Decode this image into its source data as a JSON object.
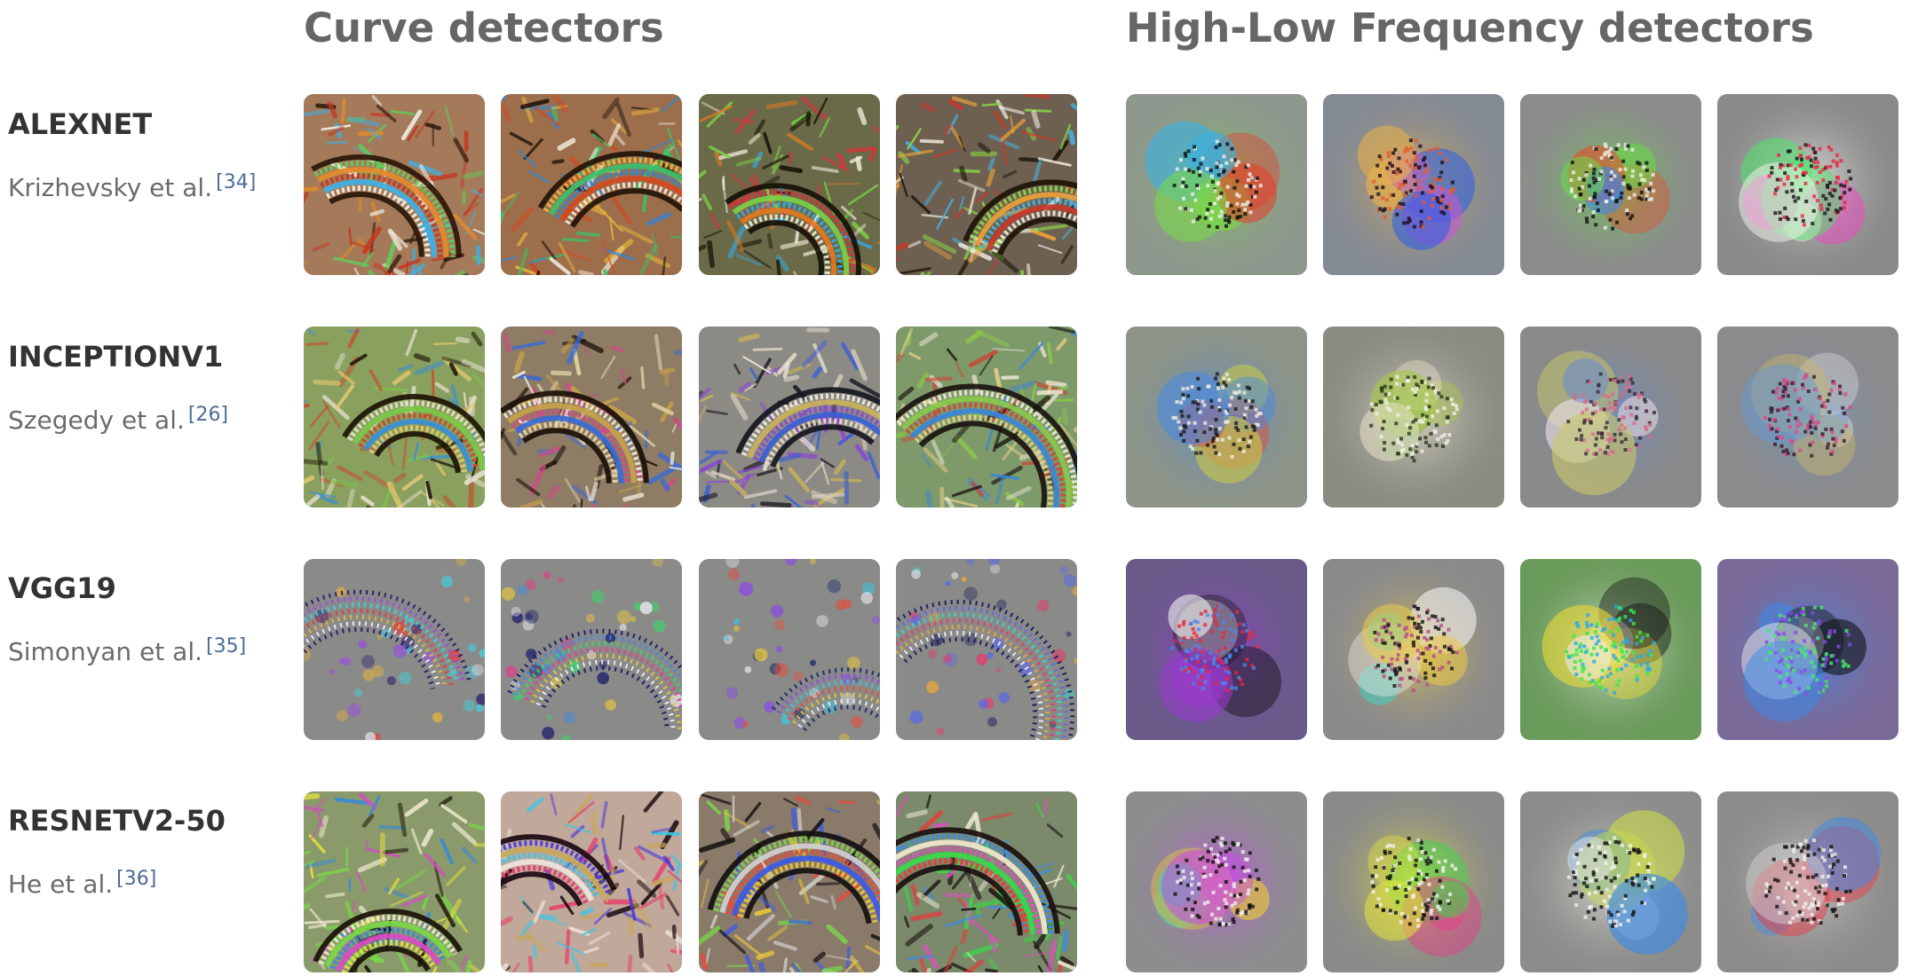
{
  "headers": {
    "curve": "Curve detectors",
    "hilo": "High-Low Frequency detectors"
  },
  "rows": [
    {
      "model": "ALEXNET",
      "authors": "Krizhevsky et al.",
      "ref": "[34]",
      "curve": [
        {
          "bg": "#a47a5a",
          "pal": [
            "#2a1608",
            "#f4f1e6",
            "#3fb0e6",
            "#c6361f",
            "#e48a2a",
            "#5fd05a"
          ],
          "kind": "arc"
        },
        {
          "bg": "#9c6e4c",
          "pal": [
            "#231308",
            "#efe9dc",
            "#d44a20",
            "#2e86d8",
            "#3cc06a",
            "#e9b73a"
          ],
          "kind": "arc"
        },
        {
          "bg": "#6a6a48",
          "pal": [
            "#161208",
            "#f0eada",
            "#e07a22",
            "#35a8e0",
            "#7bd048",
            "#d6323a"
          ],
          "kind": "arc"
        },
        {
          "bg": "#6e6050",
          "pal": [
            "#1c1408",
            "#f1ece0",
            "#c8382a",
            "#44b2e4",
            "#e9a23a",
            "#8ad84a"
          ],
          "kind": "arc"
        }
      ],
      "hilo": [
        {
          "bg": "#8e988e",
          "pal": [
            "#121212",
            "#f0f0ea",
            "#e83a2a",
            "#3ab0e4",
            "#7ad64a"
          ],
          "kind": "blob"
        },
        {
          "bg": "#848a94",
          "pal": [
            "#1a1020",
            "#e85a2a",
            "#2a5ee8",
            "#c45ad0",
            "#e8b04a"
          ],
          "kind": "blob"
        },
        {
          "bg": "#8c8c8c",
          "pal": [
            "#121212",
            "#f0eee6",
            "#e84a2a",
            "#3a8ae8",
            "#6ad84a"
          ],
          "kind": "blob"
        },
        {
          "bg": "#8a8a8a",
          "pal": [
            "#141414",
            "#e8284a",
            "#e84ac0",
            "#4ae86a",
            "#f0f0e8"
          ],
          "kind": "blob"
        }
      ]
    },
    {
      "model": "INCEPTIONV1",
      "authors": "Szegedy et al.",
      "ref": "[26]",
      "curve": [
        {
          "bg": "#8aa05e",
          "pal": [
            "#1e1408",
            "#e8c870",
            "#3a8ed8",
            "#c84a2a",
            "#7ac84a",
            "#e8e2d0"
          ],
          "kind": "arc"
        },
        {
          "bg": "#8e7c64",
          "pal": [
            "#1a1008",
            "#e8d6a8",
            "#3a6ad8",
            "#d04a8a",
            "#c8a24a",
            "#efe8da"
          ],
          "kind": "arc"
        },
        {
          "bg": "#8c8a84",
          "pal": [
            "#161620",
            "#e8dcc8",
            "#3a5ed8",
            "#8a4ad0",
            "#c8b25a",
            "#f0ecde"
          ],
          "kind": "arc"
        },
        {
          "bg": "#7e9a6a",
          "pal": [
            "#1a1410",
            "#e8cf8a",
            "#3a86d8",
            "#c84a3a",
            "#8ac84a",
            "#efe8da"
          ],
          "kind": "arc"
        }
      ],
      "hilo": [
        {
          "bg": "#8e9488",
          "pal": [
            "#1a1a1a",
            "#f0eede",
            "#c8c84a",
            "#d05a4a",
            "#4a8ae0"
          ],
          "kind": "blob"
        },
        {
          "bg": "#8a8c84",
          "pal": [
            "#2a3a1a",
            "#f2f0e8",
            "#a8c84a",
            "#7ab05a",
            "#e8e0c8"
          ],
          "kind": "blob"
        },
        {
          "bg": "#8a8a88",
          "pal": [
            "#3a2a3a",
            "#d86a8a",
            "#e8dce0",
            "#c8c86a",
            "#6a8ad0"
          ],
          "kind": "blob"
        },
        {
          "bg": "#8c8a8a",
          "pal": [
            "#3a1a2a",
            "#d84a8a",
            "#e8e2e0",
            "#c8b46a",
            "#6a9ad0"
          ],
          "kind": "blob"
        }
      ]
    },
    {
      "model": "VGG19",
      "authors": "Simonyan et al.",
      "ref": "[35]",
      "curve": [
        {
          "bg": "#8a8a88",
          "pal": [
            "#2a1a6a",
            "#f0eef8",
            "#e8b43a",
            "#e83a3a",
            "#3ad8e8",
            "#9a4ae8"
          ],
          "kind": "dots"
        },
        {
          "bg": "#8a8a88",
          "pal": [
            "#1a1a6a",
            "#f0eef8",
            "#e8c83a",
            "#e83a8a",
            "#3ad86a",
            "#3a8ae8"
          ],
          "kind": "dots"
        },
        {
          "bg": "#8a8a88",
          "pal": [
            "#1a2a6a",
            "#f0eef8",
            "#e8c83a",
            "#e84a3a",
            "#3ac8e8",
            "#8a4ae8"
          ],
          "kind": "dots"
        },
        {
          "bg": "#8a8a88",
          "pal": [
            "#1a1a5a",
            "#f0eef8",
            "#e8a83a",
            "#e83a6a",
            "#3ad8c8",
            "#5a6ae8"
          ],
          "kind": "dots"
        }
      ],
      "hilo": [
        {
          "bg": "#6a5a8a",
          "pal": [
            "#e8283a",
            "#4a8ae8",
            "#121212",
            "#f0f0f0",
            "#9a3ad0"
          ],
          "kind": "blob"
        },
        {
          "bg": "#8a8a8c",
          "pal": [
            "#b84a8a",
            "#121212",
            "#f0f0f0",
            "#3ad8c8",
            "#e8c84a"
          ],
          "kind": "blob"
        },
        {
          "bg": "#6a9a5a",
          "pal": [
            "#3ae84a",
            "#2aa8e8",
            "#121212",
            "#e8d83a",
            "#f0f0f0"
          ],
          "kind": "blob"
        },
        {
          "bg": "#7a6a9a",
          "pal": [
            "#8a4ae8",
            "#4ae86a",
            "#121212",
            "#f0f0f0",
            "#3a8ae8"
          ],
          "kind": "blob"
        }
      ]
    },
    {
      "model": "RESNETV2-50",
      "authors": "He et al.",
      "ref": "[36]",
      "curve": [
        {
          "bg": "#8a9a6a",
          "pal": [
            "#1a1208",
            "#e8e040",
            "#d84ac8",
            "#3a8ad8",
            "#7ad84a",
            "#f0ead0"
          ],
          "kind": "arc"
        },
        {
          "bg": "#c0a89a",
          "pal": [
            "#1a0a10",
            "#e83a6a",
            "#f0e4dc",
            "#3ac8e8",
            "#c8a85a",
            "#4a3ad8"
          ],
          "kind": "arc"
        },
        {
          "bg": "#8a7a6a",
          "pal": [
            "#141010",
            "#e8c83a",
            "#3a5ae8",
            "#e84a3a",
            "#d0d0d0",
            "#7ad84a"
          ],
          "kind": "arc"
        },
        {
          "bg": "#7a8a6a",
          "pal": [
            "#1a1010",
            "#e83a3a",
            "#3ad84a",
            "#e84ac8",
            "#f0e8d0",
            "#3a8ae8"
          ],
          "kind": "arc"
        }
      ],
      "hilo": [
        {
          "bg": "#8c8e8e",
          "pal": [
            "#121212",
            "#f0f0f0",
            "#e8c83a",
            "#3ad8a8",
            "#c84ae8"
          ],
          "kind": "blob"
        },
        {
          "bg": "#8a8a8a",
          "pal": [
            "#121212",
            "#f2f2f0",
            "#e83a8a",
            "#3ad84a",
            "#e8e83a"
          ],
          "kind": "blob"
        },
        {
          "bg": "#8c8c8a",
          "pal": [
            "#121212",
            "#f2f2ee",
            "#c8d84a",
            "#3a8ae8",
            "#e8e8e0"
          ],
          "kind": "blob"
        },
        {
          "bg": "#8e8c8a",
          "pal": [
            "#121212",
            "#f2f0ee",
            "#e83a4a",
            "#3a8ae8",
            "#d0d0d0"
          ],
          "kind": "blob"
        }
      ]
    }
  ]
}
